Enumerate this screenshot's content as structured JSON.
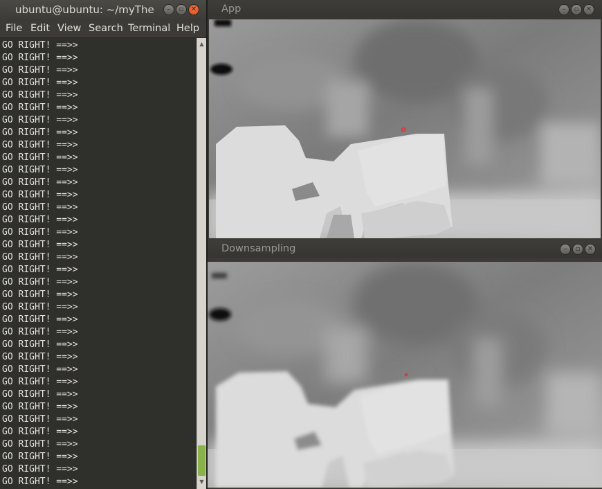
{
  "terminal": {
    "title": "ubuntu@ubuntu: ~/myThesis",
    "menu": [
      "File",
      "Edit",
      "View",
      "Search",
      "Terminal",
      "Help"
    ],
    "lines": [
      "GO RIGHT! ==>>",
      "GO RIGHT! ==>>",
      "GO RIGHT! ==>>",
      "GO RIGHT! ==>>",
      "GO RIGHT! ==>>",
      "GO RIGHT! ==>>",
      "GO RIGHT! ==>>",
      "GO RIGHT! ==>>",
      "GO RIGHT! ==>>",
      "GO RIGHT! ==>>",
      "GO RIGHT! ==>>",
      "GO RIGHT! ==>>",
      "GO RIGHT! ==>>",
      "GO RIGHT! ==>>",
      "GO RIGHT! ==>>",
      "GO RIGHT! ==>>",
      "GO RIGHT! ==>>",
      "GO RIGHT! ==>>",
      "GO RIGHT! ==>>",
      "GO RIGHT! ==>>",
      "GO RIGHT! ==>>",
      "GO RIGHT! ==>>",
      "GO RIGHT! ==>>",
      "GO RIGHT! ==>>",
      "GO RIGHT! ==>>",
      "GO RIGHT! ==>>",
      "GO RIGHT! ==>>",
      "GO RIGHT! ==>>",
      "GO RIGHT! ==>>",
      "GO RIGHT! ==>>",
      "GO RIGHT! ==>>",
      "GO RIGHT! ==>>",
      "GO RIGHT! ==>>",
      "GO RIGHT! ==>>",
      "GO RIGHT! ==>>",
      "GO RIGHT! ==>>"
    ]
  },
  "windows": {
    "app_title": "App",
    "downsampling_title": "Downsampling"
  },
  "colors": {
    "close_button": "#e05a2b",
    "scroll_thumb": "#8ab24a",
    "marker": "#e03030"
  }
}
